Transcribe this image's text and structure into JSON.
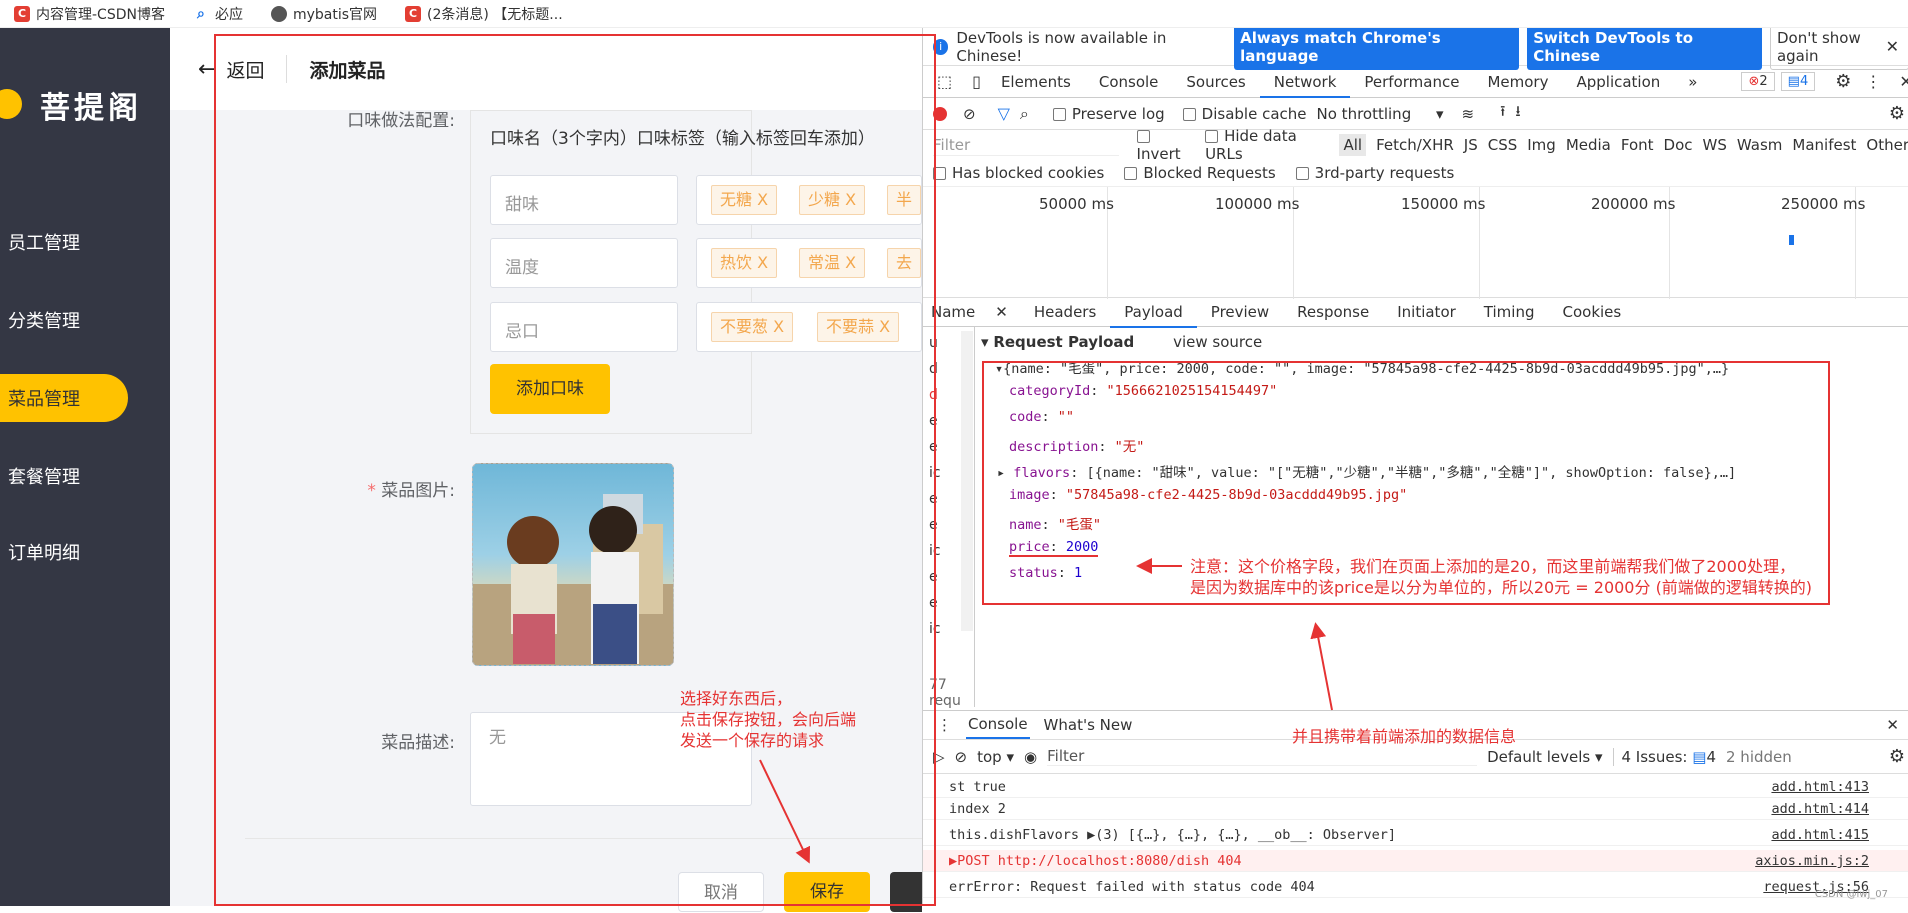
{
  "bookmarks": [
    {
      "label": "内容管理-CSDN博客",
      "icon": "csdn-icon",
      "color": "#e33e33"
    },
    {
      "label": "必应",
      "icon": "search-icon",
      "color": "#1a73e8"
    },
    {
      "label": "mybatis官网",
      "icon": "globe-icon",
      "color": "#555555"
    },
    {
      "label": "(2条消息) 【无标题...",
      "icon": "csdn-icon",
      "color": "#e33e33"
    }
  ],
  "sidebar": {
    "logo": "菩提阁",
    "items": [
      {
        "label": "员工管理",
        "active": false
      },
      {
        "label": "分类管理",
        "active": false
      },
      {
        "label": "菜品管理",
        "active": true
      },
      {
        "label": "套餐管理",
        "active": false
      },
      {
        "label": "订单明细",
        "active": false
      }
    ]
  },
  "header": {
    "back": "返回",
    "title": "添加菜品"
  },
  "form": {
    "flavor_label": "口味做法配置:",
    "flavor_head": "口味名（3个字内）口味标签（输入标签回车添加）",
    "flavors": [
      {
        "name": "甜味",
        "tags": [
          "无糖 X",
          "少糖 X",
          "半"
        ]
      },
      {
        "name": "温度",
        "tags": [
          "热饮 X",
          "常温 X",
          "去"
        ]
      },
      {
        "name": "忌口",
        "tags": [
          "不要葱 X",
          "不要蒜 X"
        ]
      }
    ],
    "add_flavor": "添加口味",
    "image_required": "*",
    "image_label": "菜品图片:",
    "desc_label": "菜品描述:",
    "desc_placeholder": "无",
    "cancel": "取消",
    "save": "保存"
  },
  "annotations": {
    "save_note": [
      "选择好东西后，",
      "点击保存按钮，会向后端",
      "发送一个保存的请求"
    ],
    "price_note": [
      "注意：这个价格字段，我们在页面上添加的是20，而这里前端帮我们做了2000处理，",
      "是因为数据库中的该price是以分为单位的，所以20元 = 2000分    (前端做的逻辑转换的)"
    ],
    "carry_note": "并且携带着前端添加的数据信息"
  },
  "devtools": {
    "info": "DevTools is now available in Chinese!",
    "btn_match": "Always match Chrome's language",
    "btn_switch": "Switch DevTools to Chinese",
    "btn_dont": "Don't show again",
    "tabs": [
      "Elements",
      "Console",
      "Sources",
      "Network",
      "Performance",
      "Memory",
      "Application",
      "»"
    ],
    "active_tab": "Network",
    "errors": "2",
    "messages": "4",
    "preserve_log": "Preserve log",
    "disable_cache": "Disable cache",
    "throttling": "No throttling",
    "filter_placeholder": "Filter",
    "invert": "Invert",
    "hide_data": "Hide data URLs",
    "types": [
      "All",
      "Fetch/XHR",
      "JS",
      "CSS",
      "Img",
      "Media",
      "Font",
      "Doc",
      "WS",
      "Wasm",
      "Manifest",
      "Other"
    ],
    "blocked_cookies": "Has blocked cookies",
    "blocked_requests": "Blocked Requests",
    "third_party": "3rd-party requests",
    "timeline": [
      "50000 ms",
      "100000 ms",
      "150000 ms",
      "200000 ms",
      "250000 ms"
    ],
    "name_col": "Name",
    "req_tabs": [
      "Headers",
      "Payload",
      "Preview",
      "Response",
      "Initiator",
      "Timing",
      "Cookies"
    ],
    "active_req_tab": "Payload",
    "name_rows": [
      "u",
      "d",
      "d",
      "e",
      "e",
      "ic",
      "e",
      "e",
      "ic",
      "e",
      "e",
      "ic"
    ],
    "req_count": "77 requ",
    "payload_title": "Request Payload",
    "view_source": "view source",
    "payload_summary": "{name: \"毛蛋\", price: 2000, code: \"\", image: \"57845a98-cfe2-4425-8b9d-03acddd49b95.jpg\",…}",
    "payload_fields": [
      {
        "key": "categoryId",
        "value": "\"1566621025154154497\"",
        "kind": "s"
      },
      {
        "key": "code",
        "value": "\"\"",
        "kind": "s"
      },
      {
        "key": "description",
        "value": "\"无\"",
        "kind": "s"
      },
      {
        "key": "flavors",
        "value": "[{name: \"甜味\", value: \"[\"无糖\",\"少糖\",\"半糖\",\"多糖\",\"全糖\"]\", showOption: false},…]",
        "kind": "o"
      },
      {
        "key": "image",
        "value": "\"57845a98-cfe2-4425-8b9d-03acddd49b95.jpg\"",
        "kind": "s"
      },
      {
        "key": "name",
        "value": "\"毛蛋\"",
        "kind": "s"
      },
      {
        "key": "price",
        "value": "2000",
        "kind": "n"
      },
      {
        "key": "status",
        "value": "1",
        "kind": "n"
      }
    ],
    "console_tabs": [
      "Console",
      "What's New"
    ],
    "console_context": "top",
    "console_filter": "Filter",
    "levels": "Default levels",
    "issues": "4 Issues:",
    "issues_count": "4",
    "hidden": "2 hidden",
    "console_lines": [
      {
        "text": "st true",
        "src": "add.html:413",
        "err": false
      },
      {
        "text": "index 2",
        "src": "add.html:414",
        "err": false
      },
      {
        "text": "this.dishFlavors ▶(3) [{…}, {…}, {…}, __ob__: Observer]",
        "src": "add.html:415",
        "err": false
      },
      {
        "text": "▶POST http://localhost:8080/dish 404",
        "src": "axios.min.js:2",
        "err": true
      },
      {
        "text": "errError: Request failed with status code 404",
        "src": "request.js:56",
        "err": false
      }
    ],
    "watermark": "CSDN @lwj_07"
  }
}
